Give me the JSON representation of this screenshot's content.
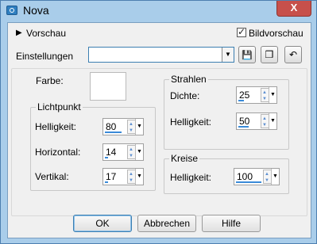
{
  "window": {
    "title": "Nova",
    "close_glyph": "X"
  },
  "preview": {
    "label": "Vorschau",
    "chevron": "▶"
  },
  "image_preview": {
    "label": "Bildvorschau",
    "checked": true
  },
  "settings": {
    "label": "Einstellungen",
    "value": ""
  },
  "toolbar": {
    "save_glyph": "💾",
    "cube_glyph": "❒",
    "reset_glyph": "↶"
  },
  "farbe": {
    "label": "Farbe:"
  },
  "lichtpunkt": {
    "title": "Lichtpunkt",
    "helligkeit": {
      "label": "Helligkeit:",
      "value": "80",
      "level": 0.8
    },
    "horizontal": {
      "label": "Horizontal:",
      "value": "14",
      "level": 0.14
    },
    "vertikal": {
      "label": "Vertikal:",
      "value": "17",
      "level": 0.17
    }
  },
  "strahlen": {
    "title": "Strahlen",
    "dichte": {
      "label": "Dichte:",
      "value": "25",
      "level": 0.25
    },
    "helligkeit": {
      "label": "Helligkeit:",
      "value": "50",
      "level": 0.5
    }
  },
  "kreise": {
    "title": "Kreise",
    "helligkeit": {
      "label": "Helligkeit:",
      "value": "100",
      "level": 1.0
    }
  },
  "buttons": {
    "ok": "OK",
    "cancel": "Abbrechen",
    "help": "Hilfe"
  },
  "colors": {
    "accent": "#3a8ad8",
    "title_bg": "#a9cdea",
    "close_bg": "#c7504b"
  }
}
